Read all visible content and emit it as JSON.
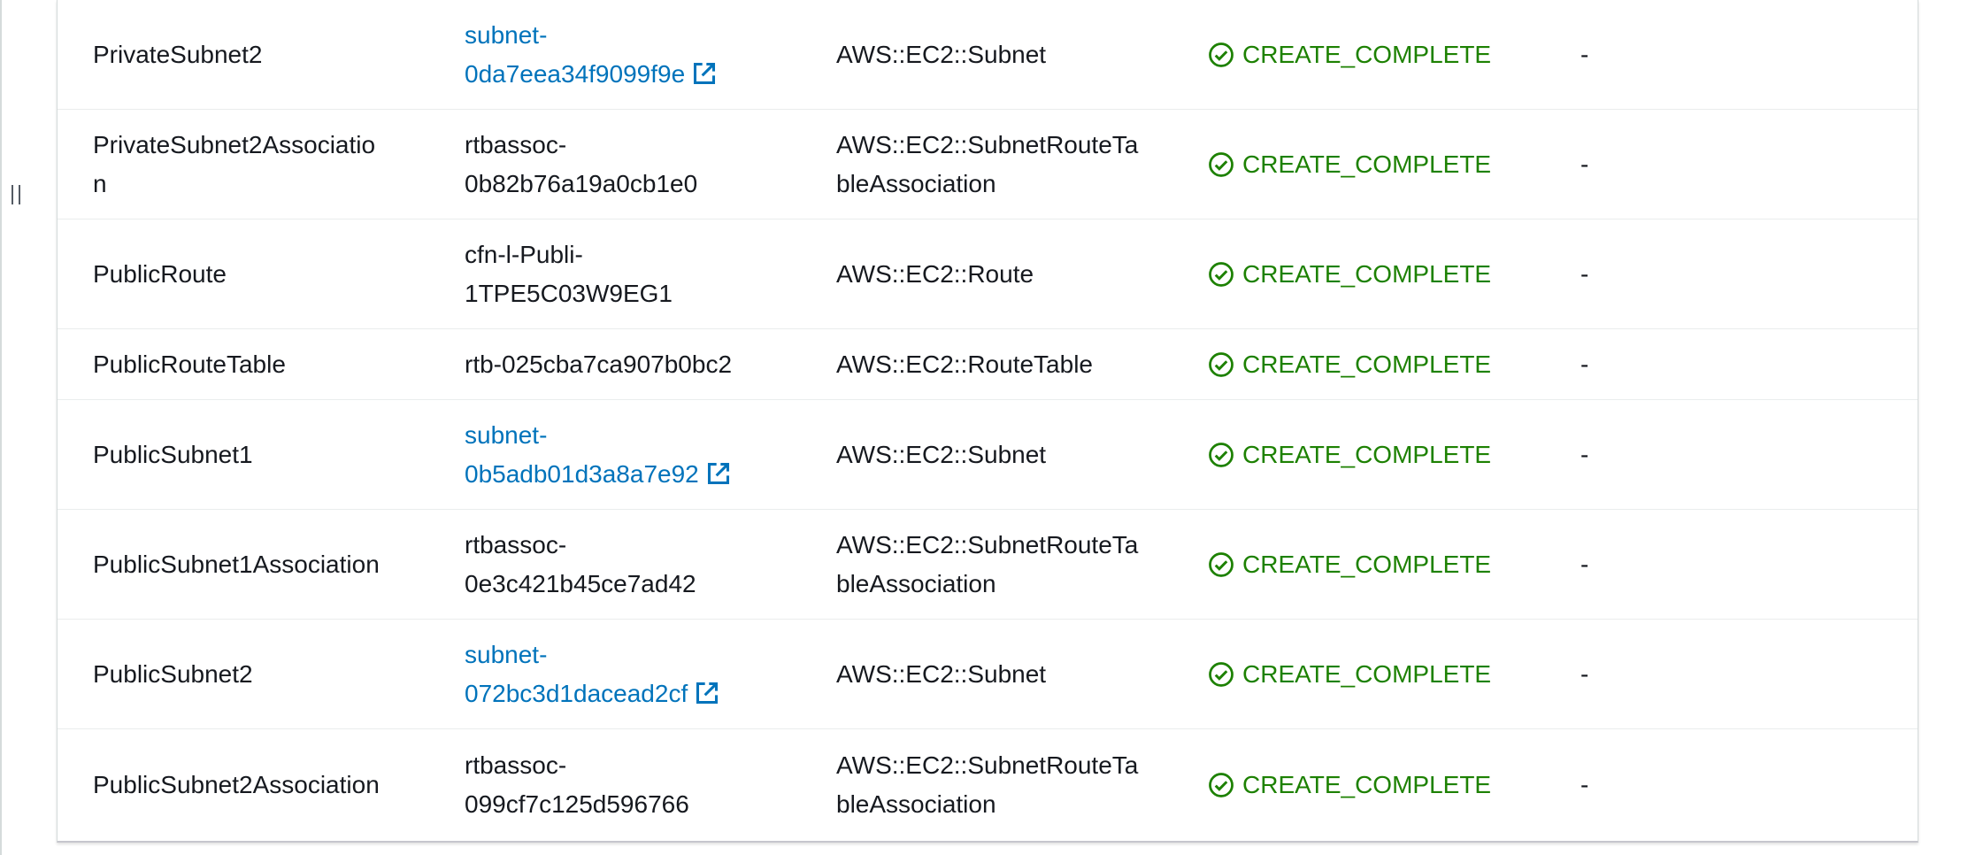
{
  "table": {
    "rows": [
      {
        "logical_id": "PrivateSubnet2",
        "physical_id_lines": [
          "subnet-",
          "0da7eea34f9099f9e"
        ],
        "is_link": true,
        "type_lines": [
          "AWS::EC2::Subnet"
        ],
        "status": "CREATE_COMPLETE",
        "reason": "-"
      },
      {
        "logical_id_lines": [
          "PrivateSubnet2Associatio",
          "n"
        ],
        "physical_id_lines": [
          "rtbassoc-",
          "0b82b76a19a0cb1e0"
        ],
        "is_link": false,
        "type_lines": [
          "AWS::EC2::SubnetRouteTa",
          "bleAssociation"
        ],
        "status": "CREATE_COMPLETE",
        "reason": "-"
      },
      {
        "logical_id": "PublicRoute",
        "physical_id_lines": [
          "cfn-l-Publi-",
          "1TPE5C03W9EG1"
        ],
        "is_link": false,
        "type_lines": [
          "AWS::EC2::Route"
        ],
        "status": "CREATE_COMPLETE",
        "reason": "-"
      },
      {
        "logical_id": "PublicRouteTable",
        "physical_id_lines": [
          "rtb-025cba7ca907b0bc2"
        ],
        "is_link": false,
        "type_lines": [
          "AWS::EC2::RouteTable"
        ],
        "status": "CREATE_COMPLETE",
        "reason": "-"
      },
      {
        "logical_id": "PublicSubnet1",
        "physical_id_lines": [
          "subnet-",
          "0b5adb01d3a8a7e92"
        ],
        "is_link": true,
        "type_lines": [
          "AWS::EC2::Subnet"
        ],
        "status": "CREATE_COMPLETE",
        "reason": "-"
      },
      {
        "logical_id": "PublicSubnet1Association",
        "physical_id_lines": [
          "rtbassoc-",
          "0e3c421b45ce7ad42"
        ],
        "is_link": false,
        "type_lines": [
          "AWS::EC2::SubnetRouteTa",
          "bleAssociation"
        ],
        "status": "CREATE_COMPLETE",
        "reason": "-"
      },
      {
        "logical_id": "PublicSubnet2",
        "physical_id_lines": [
          "subnet-",
          "072bc3d1dacead2cf"
        ],
        "is_link": true,
        "type_lines": [
          "AWS::EC2::Subnet"
        ],
        "status": "CREATE_COMPLETE",
        "reason": "-"
      },
      {
        "logical_id": "PublicSubnet2Association",
        "physical_id_lines": [
          "rtbassoc-",
          "099cf7c125d596766"
        ],
        "is_link": false,
        "type_lines": [
          "AWS::EC2::SubnetRouteTa",
          "bleAssociation"
        ],
        "status": "CREATE_COMPLETE",
        "reason": "-"
      }
    ]
  },
  "icons": {
    "status": "check-circle-icon",
    "external_link": "external-link-icon",
    "drag_handle": "drag-handle-icon"
  },
  "colors": {
    "link": "#0073bb",
    "success": "#1d8102",
    "text": "#16191f",
    "row_divider": "#eaeded"
  }
}
